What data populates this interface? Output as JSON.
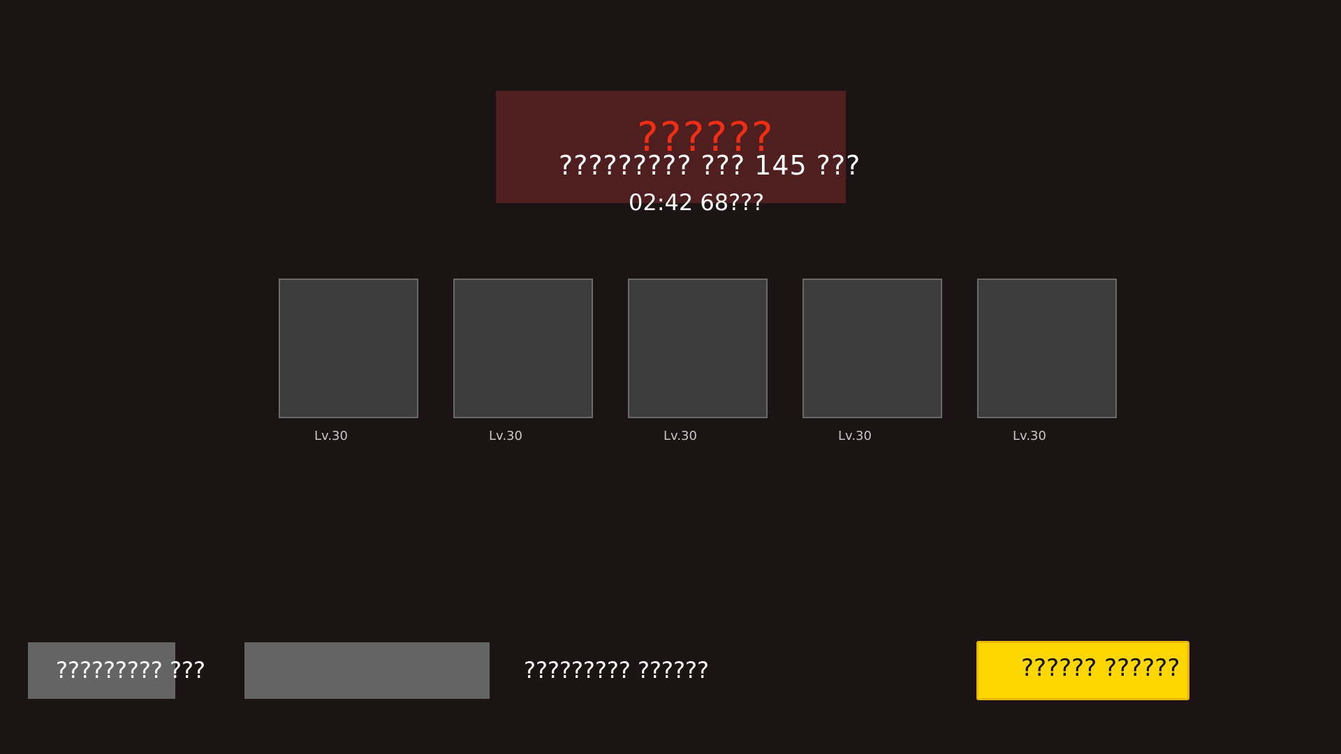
{
  "header": {
    "title": "??????",
    "subtitle": "????????? ??? 145 ???",
    "time": "02:42 68???"
  },
  "slots": [
    {
      "level": "Lv.30"
    },
    {
      "level": "Lv.30"
    },
    {
      "level": "Lv.30"
    },
    {
      "level": "Lv.30"
    },
    {
      "level": "Lv.30"
    }
  ],
  "footer": {
    "left_button_label": "????????? ???",
    "middle_text": "????????? ??????",
    "start_button_label": "?????? ??????"
  },
  "colors": {
    "background": "#1c1414",
    "banner": "#4f1f20",
    "title": "#ef2e16",
    "slot_fill": "#3c3c3c",
    "button_gray": "#646464",
    "start_button": "#ffd700"
  }
}
